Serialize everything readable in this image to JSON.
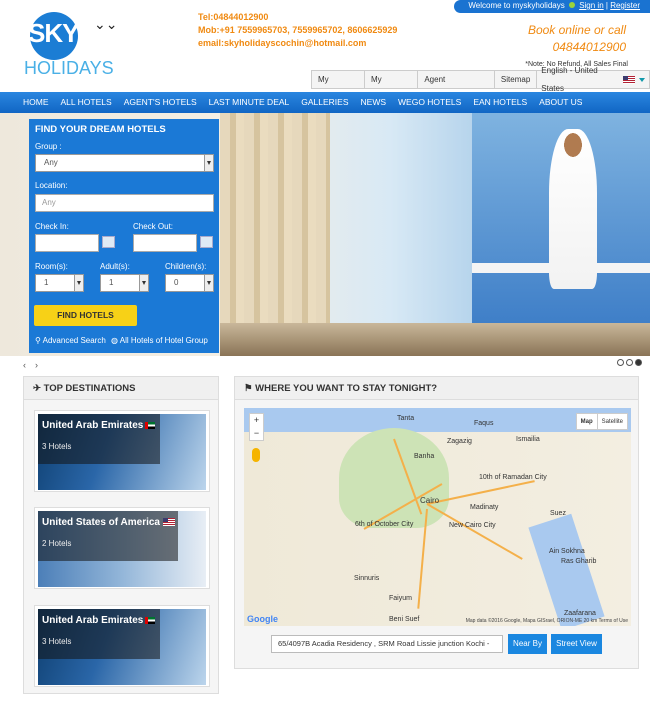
{
  "brand": {
    "logo_top": "SKY",
    "logo_bottom": "HOLIDAYS"
  },
  "contact": {
    "tel": "Tel:04844012900",
    "mob": "Mob:+91 7559965703, 7559965702, 8606625929",
    "email": "email:skyholidayscochin@hotmail.com"
  },
  "userbar": {
    "welcome": "Welcome to myskyholidays",
    "signin": "Sign in",
    "sep": "|",
    "register": "Register"
  },
  "book": {
    "line1": "Book online or call",
    "phone": "04844012900",
    "note": "*Note: No Refund, All Sales Final"
  },
  "toplinks": [
    "My Account",
    "My Booking",
    "Agent Registration",
    "Sitemap"
  ],
  "language": {
    "selected": "English - United States"
  },
  "nav": [
    "HOME",
    "ALL HOTELS",
    "AGENT'S HOTELS",
    "LAST MINUTE DEAL",
    "GALLERIES",
    "NEWS",
    "WEGO HOTELS",
    "EAN HOTELS",
    "ABOUT US"
  ],
  "search": {
    "title": "FIND YOUR DREAM HOTELS",
    "group_label": "Group :",
    "group_value": "Any",
    "location_label": "Location:",
    "location_placeholder": "Any",
    "checkin_label": "Check In:",
    "checkout_label": "Check Out:",
    "rooms_label": "Room(s):",
    "adults_label": "Adult(s):",
    "children_label": "Children(s):",
    "rooms_value": "1",
    "adults_value": "1",
    "children_value": "0",
    "find_button": "FIND HOTELS",
    "advanced": "Advanced Search",
    "all_hotels": "All Hotels of Hotel Group"
  },
  "slider": {
    "prev": "‹",
    "next": "›"
  },
  "destinations": {
    "title": "TOP DESTINATIONS",
    "items": [
      {
        "name": "United Arab Emirates",
        "count": "3 Hotels",
        "flag": "ae"
      },
      {
        "name": "United States of America",
        "count": "2 Hotels",
        "flag": "us"
      },
      {
        "name": "United Arab Emirates",
        "count": "3 Hotels",
        "flag": "ae"
      }
    ]
  },
  "map": {
    "title": "WHERE YOU WANT TO STAY TONIGHT?",
    "type_map": "Map",
    "type_satellite": "Satellite",
    "zoom_in": "+",
    "zoom_out": "−",
    "google": "Google",
    "attribution": "Map data ©2016 Google, Mapa GISrael, ORION-ME   20 km   Terms of Use",
    "cities": [
      "Tanta",
      "Faqus",
      "Zagazig",
      "Ismailia",
      "Banha",
      "Cairo",
      "10th of Ramadan City",
      "Madinaty",
      "6th of October City",
      "New Cairo City",
      "Suez",
      "Ain Sokhna",
      "Ras Gharib",
      "Faiyum",
      "Beni Suef",
      "Zaafarana",
      "Sinnuris"
    ],
    "address": "65/4097B Acadia Residency , SRM Road Lissie junction Kochi -",
    "near_by": "Near By",
    "street_view": "Street View"
  },
  "colors": {
    "brand_blue": "#1a73d1",
    "accent_orange": "#f08a12",
    "find_yellow": "#f7d117"
  }
}
